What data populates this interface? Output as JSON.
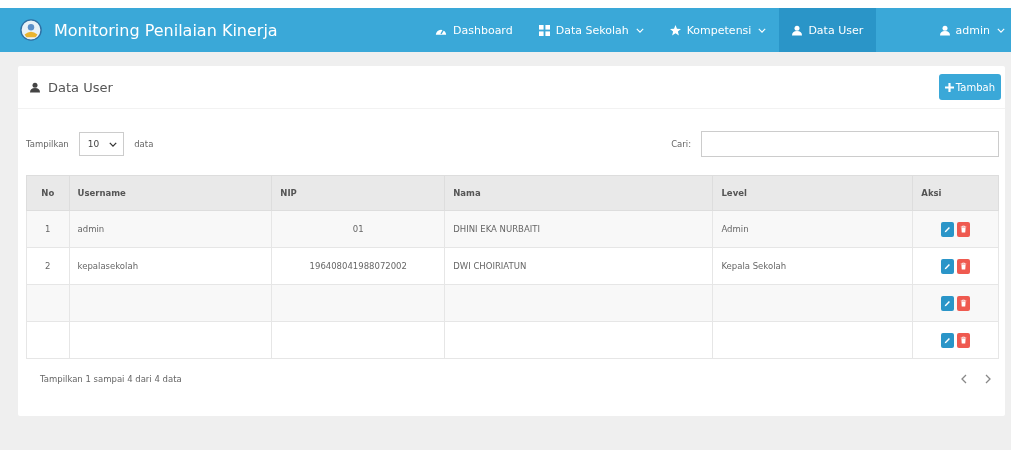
{
  "navbar": {
    "brand": "Monitoring Penilaian Kinerja",
    "items": [
      {
        "label": "Dashboard",
        "dropdown": false,
        "selected": false
      },
      {
        "label": "Data Sekolah",
        "dropdown": true,
        "selected": false
      },
      {
        "label": "Kompetensi",
        "dropdown": true,
        "selected": false
      },
      {
        "label": "Data User",
        "dropdown": false,
        "selected": true
      }
    ],
    "user_menu": {
      "label": "admin"
    }
  },
  "panel": {
    "title": "Data User",
    "add_button": "Tambah"
  },
  "controls": {
    "show_label": "Tampilkan",
    "page_size": "10",
    "show_suffix": "data",
    "search_label": "Cari:"
  },
  "table": {
    "columns": [
      "No",
      "Username",
      "NIP",
      "Nama",
      "Level",
      "Aksi"
    ],
    "rows": [
      {
        "no": "1",
        "username": "admin",
        "nip": "01",
        "nama": "DHINI EKA NURBAITI",
        "level": "Admin"
      },
      {
        "no": "2",
        "username": "kepalasekolah",
        "nip": "196408041988072002",
        "nama": "DWI CHOIRIATUN",
        "level": "Kepala Sekolah"
      },
      {},
      {}
    ]
  },
  "footer": {
    "info": "Tampilkan 1 sampai 4 dari 4 data"
  }
}
